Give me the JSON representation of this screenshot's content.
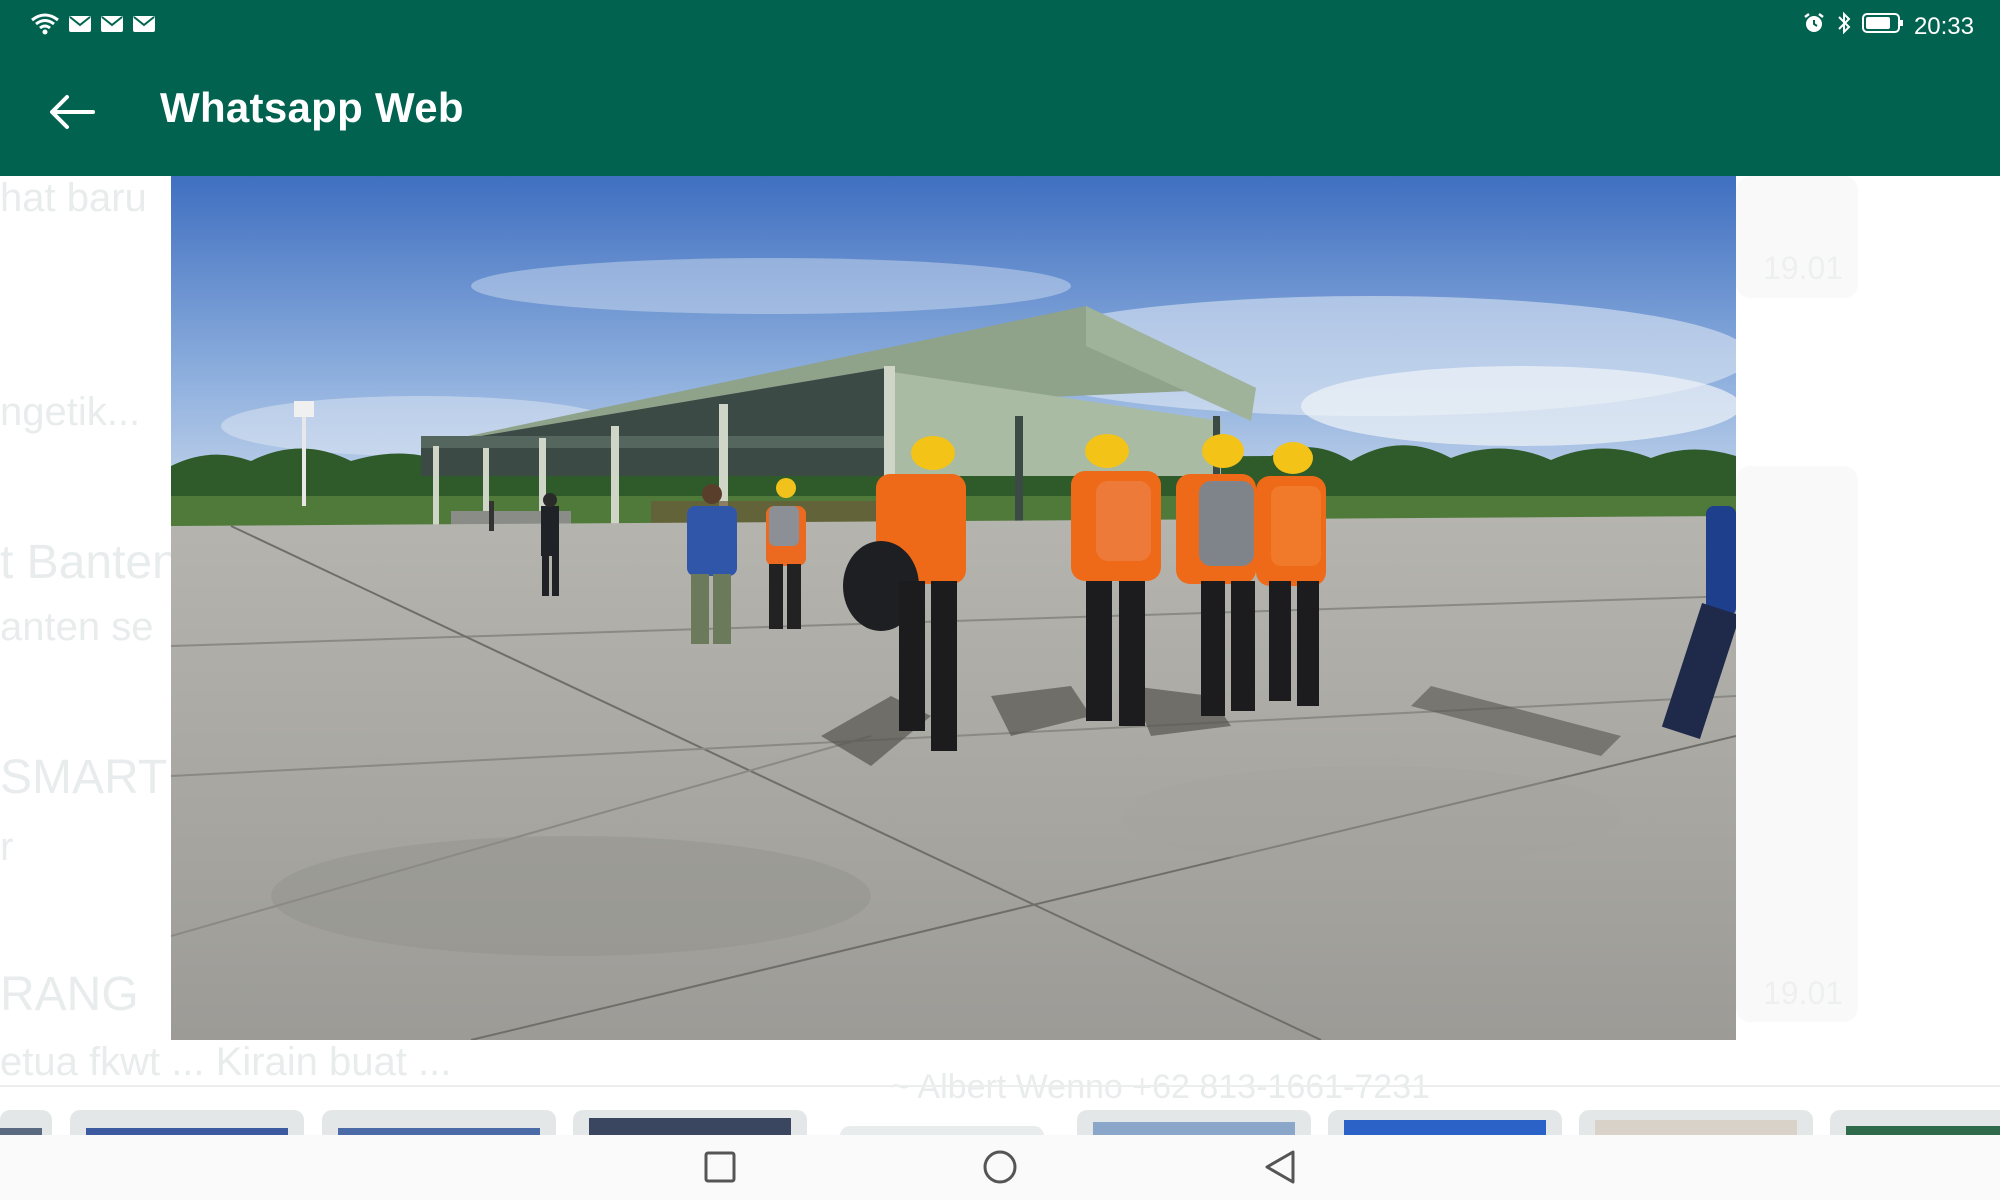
{
  "status_bar": {
    "time": "20:33",
    "left_icons": [
      "wifi-icon",
      "mail-icon",
      "mail-icon",
      "mail-icon"
    ],
    "right_icons": [
      "alarm-icon",
      "bluetooth-icon",
      "battery-icon"
    ]
  },
  "app_bar": {
    "title": "Whatsapp Web",
    "back_icon": "arrow-left-icon"
  },
  "background_chats": [
    {
      "text": "hat baru"
    },
    {
      "text": "ngetik..."
    },
    {
      "text": "t Banten"
    },
    {
      "text": "anten se"
    },
    {
      "text": "SMART"
    },
    {
      "text": "r"
    },
    {
      "text": "RANG"
    },
    {
      "text": "etua fkwt ... Kirain buat ..."
    }
  ],
  "background_times": [
    "19.01",
    "19.01"
  ],
  "background_sender": "~ Albert Wenno +62 813-1661-7231",
  "nav_bar": {
    "buttons": [
      "recent-apps-icon",
      "home-icon",
      "back-triangle-icon"
    ]
  },
  "colors": {
    "brand": "#00624f",
    "background": "#ffffff"
  }
}
